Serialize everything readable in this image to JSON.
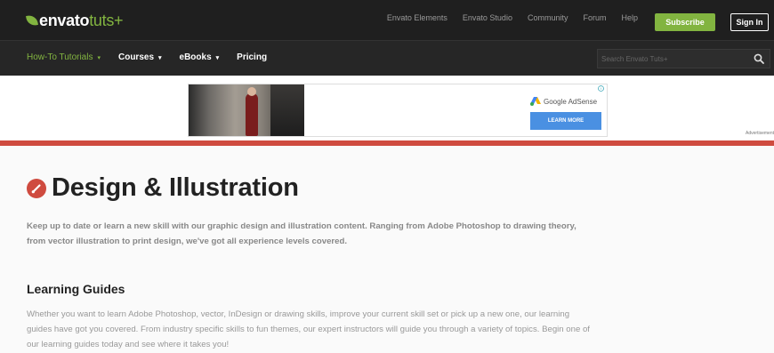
{
  "header": {
    "logo": {
      "brand": "envato",
      "product": "tuts+"
    },
    "top_links": [
      "Envato Elements",
      "Envato Studio",
      "Community",
      "Forum",
      "Help"
    ],
    "subscribe_label": "Subscribe",
    "signin_label": "Sign In",
    "colors": {
      "accent": "#82b440",
      "topbar": "#1f1f1f",
      "navbar": "#262626"
    }
  },
  "nav": {
    "items": [
      {
        "label": "How-To Tutorials",
        "active": true,
        "caret": "▾"
      },
      {
        "label": "Courses",
        "active": false,
        "caret": "▾"
      },
      {
        "label": "eBooks",
        "active": false,
        "caret": "▾"
      },
      {
        "label": "Pricing",
        "active": false,
        "caret": ""
      }
    ],
    "search": {
      "placeholder": "Search Envato Tuts+",
      "icon": "search-icon"
    }
  },
  "ad": {
    "provider": "Google AdSense",
    "cta": "LEARN MORE",
    "label": "Advertisement",
    "colors": {
      "cta": "#4a90e2",
      "divider": "#cf4b3f"
    }
  },
  "main": {
    "category_icon": "design-icon",
    "title": "Design & Illustration",
    "intro": "Keep up to date or learn a new skill with our graphic design and illustration content. Ranging from Adobe Photoshop to drawing theory, from vector illustration to print design, we've got all experience levels covered.",
    "guides_title": "Learning Guides",
    "guides_text": "Whether you want to learn Adobe Photoshop, vector, InDesign or drawing skills, improve your current skill set or pick up a new one, our learning guides have got you covered. From industry specific skills to fun themes, our expert instructors will guide you through a variety of topics. Begin one of our learning guides today and see where it takes you!"
  }
}
